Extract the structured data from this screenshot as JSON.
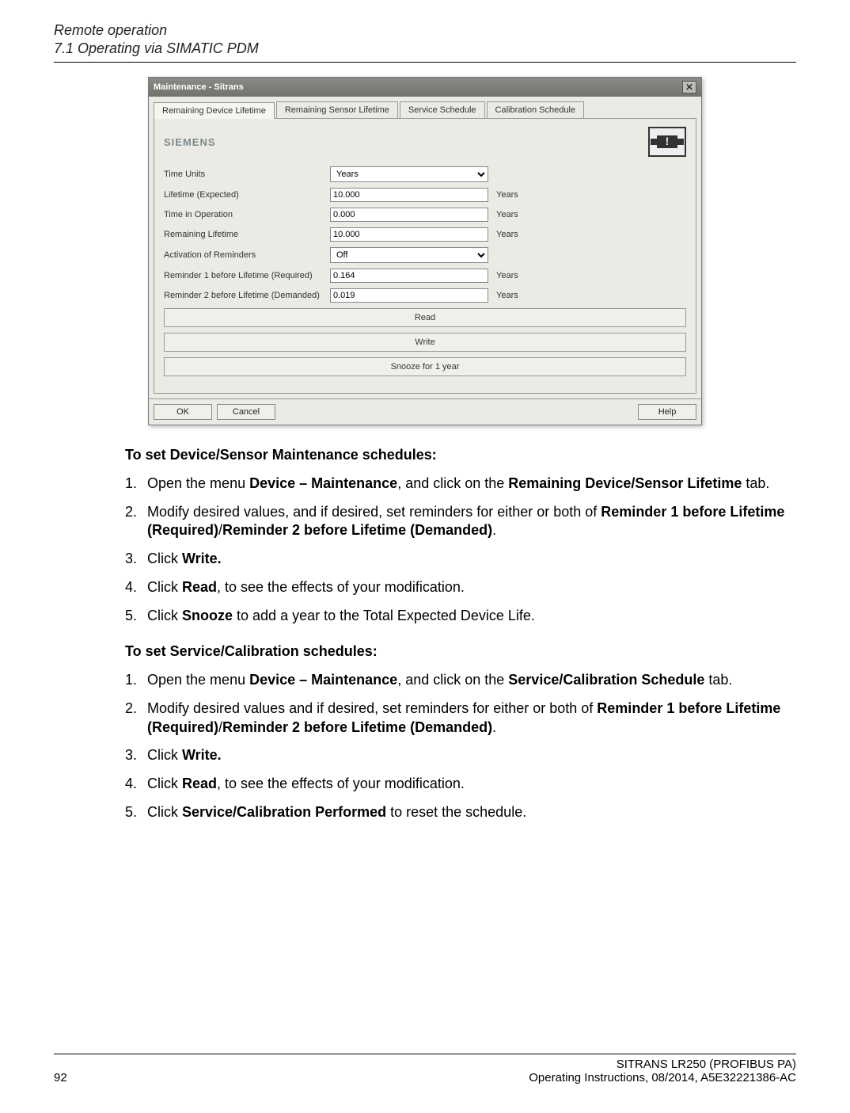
{
  "header": {
    "title": "Remote operation",
    "subtitle": "7.1 Operating via SIMATIC PDM"
  },
  "dialog": {
    "title": "Maintenance - Sitrans",
    "tabs": [
      "Remaining Device Lifetime",
      "Remaining Sensor Lifetime",
      "Service Schedule",
      "Calibration Schedule"
    ],
    "brand": "SIEMENS",
    "fields": {
      "time_units": {
        "label": "Time Units",
        "value": "Years"
      },
      "lifetime_expected": {
        "label": "Lifetime (Expected)",
        "value": "10.000",
        "unit": "Years"
      },
      "time_in_operation": {
        "label": "Time in Operation",
        "value": "0.000",
        "unit": "Years"
      },
      "remaining_lifetime": {
        "label": "Remaining Lifetime",
        "value": "10.000",
        "unit": "Years"
      },
      "activation_of_reminders": {
        "label": "Activation of Reminders",
        "value": "Off"
      },
      "reminder1": {
        "label": "Reminder 1 before Lifetime (Required)",
        "value": "0.164",
        "unit": "Years"
      },
      "reminder2": {
        "label": "Reminder 2 before Lifetime (Demanded)",
        "value": "0.019",
        "unit": "Years"
      }
    },
    "wide_buttons": {
      "read": "Read",
      "write": "Write",
      "snooze": "Snooze for 1 year"
    },
    "bottom_buttons": {
      "ok": "OK",
      "cancel": "Cancel",
      "help": "Help"
    }
  },
  "section1": {
    "title": "To set Device/Sensor Maintenance schedules:",
    "steps": {
      "s1a": "Open the menu ",
      "s1b": "Device – Maintenance",
      "s1c": ", and click on the ",
      "s1d": "Remaining Device/Sensor Lifetime",
      "s1e": " tab.",
      "s2a": "Modify desired values, and if desired, set reminders for either or both of ",
      "s2b": "Reminder 1 before Lifetime (Required)",
      "s2c": "/",
      "s2d": "Reminder 2 before Lifetime (Demanded)",
      "s2e": ".",
      "s3a": "Click ",
      "s3b": "Write.",
      "s4a": "Click ",
      "s4b": "Read",
      "s4c": ", to see the effects of your modification.",
      "s5a": "Click ",
      "s5b": "Snooze",
      "s5c": " to add a year to the Total Expected Device Life."
    }
  },
  "section2": {
    "title": "To set Service/Calibration schedules:",
    "steps": {
      "s1a": "Open the menu ",
      "s1b": "Device – Maintenance",
      "s1c": ", and click on the ",
      "s1d": "Service/Calibration Schedule",
      "s1e": " tab.",
      "s2a": "Modify desired values and if desired, set reminders for either or both of ",
      "s2b": "Reminder 1 before Lifetime (Required)",
      "s2c": "/",
      "s2d": "Reminder 2 before Lifetime (Demanded)",
      "s2e": ".",
      "s3a": "Click ",
      "s3b": "Write.",
      "s4a": "Click ",
      "s4b": "Read",
      "s4c": ", to see the effects of your modification.",
      "s5a": "Click ",
      "s5b": "Service/Calibration Performed",
      "s5c": " to reset the schedule."
    }
  },
  "footer": {
    "line1": "SITRANS LR250 (PROFIBUS PA)",
    "page": "92",
    "line2": "Operating Instructions, 08/2014, A5E32221386-AC"
  }
}
